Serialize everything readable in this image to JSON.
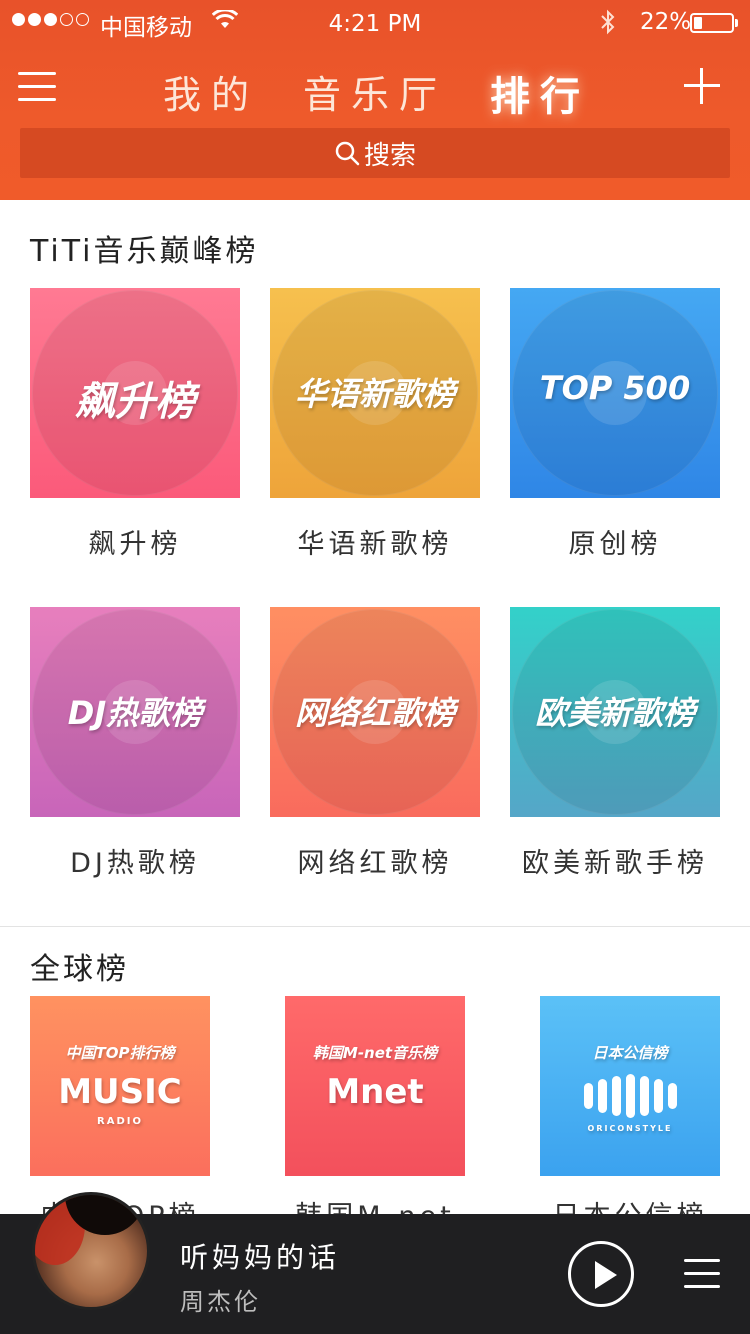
{
  "status_bar": {
    "carrier": "中国移动",
    "time": "4:21 PM",
    "battery": "22%",
    "battery_level": 0.22,
    "signal_bars": 3,
    "icons": [
      "signal-icon",
      "wifi-icon",
      "bluetooth-icon",
      "battery-icon"
    ]
  },
  "nav": {
    "tabs": [
      {
        "label": "我的"
      },
      {
        "label": "音乐厅"
      },
      {
        "label": "排行",
        "active": true
      }
    ],
    "menu_icon": "menu-icon",
    "add_icon": "plus-icon"
  },
  "search": {
    "label": "搜索",
    "icon": "search-icon"
  },
  "peak": {
    "title": "TiTi音乐巅峰榜",
    "items": [
      {
        "art": "飙升榜",
        "label": "飙升榜",
        "colors": [
          "#ff7a93",
          "#fb5a7a"
        ]
      },
      {
        "art": "华语新歌榜",
        "label": "华语新歌榜",
        "colors": [
          "#f6c04e",
          "#eea43a"
        ]
      },
      {
        "art": "TOP 500",
        "label": "原创榜",
        "colors": [
          "#45a8f3",
          "#2f86e6"
        ]
      },
      {
        "art": "DJ热歌榜",
        "label": "DJ热歌榜",
        "colors": [
          "#e77fbd",
          "#c865b9"
        ]
      },
      {
        "art": "网络红歌榜",
        "label": "网络红歌榜",
        "colors": [
          "#ff8f62",
          "#f96b5d"
        ]
      },
      {
        "art": "欧美新歌榜",
        "label": "欧美新歌手榜",
        "colors": [
          "#33d1c9",
          "#55a6c8"
        ]
      }
    ]
  },
  "global": {
    "title": "全球榜",
    "items": [
      {
        "art_top": "中国TOP排行榜",
        "art_main": "MUSIC",
        "art_sub": "RADIO",
        "label": "中国TOP榜",
        "colors": [
          "#ff9260",
          "#fb6f5d"
        ]
      },
      {
        "art_top": "韩国M-net音乐榜",
        "art_main": "Mnet",
        "art_sub": "",
        "label": "韩国M-net榜",
        "colors": [
          "#ff6a6a",
          "#f3505c"
        ]
      },
      {
        "art_top": "日本公信榜",
        "art_main": "",
        "art_sub": "ORICONSTYLE",
        "label": "日本公信榜",
        "colors": [
          "#5bc1f7",
          "#3ba2ef"
        ]
      }
    ]
  },
  "player": {
    "title": "听妈妈的话",
    "artist": "周杰伦",
    "play_icon": "play-icon",
    "list_icon": "playlist-icon"
  }
}
